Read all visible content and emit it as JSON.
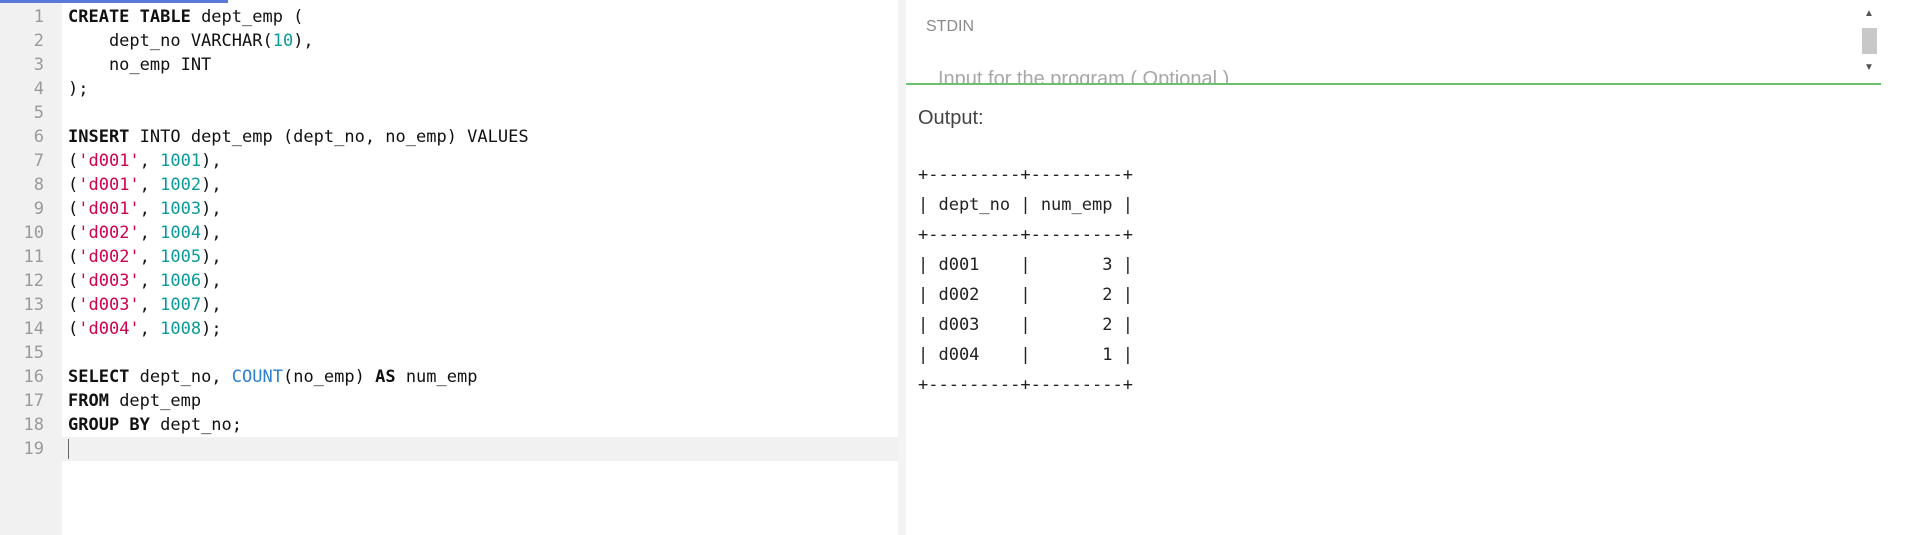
{
  "editor": {
    "lines": [
      {
        "n": "1",
        "tokens": [
          {
            "t": "CREATE TABLE",
            "c": "kw"
          },
          {
            "t": " dept_emp (",
            "c": ""
          }
        ]
      },
      {
        "n": "2",
        "tokens": [
          {
            "t": "    dept_no VARCHAR(",
            "c": ""
          },
          {
            "t": "10",
            "c": "num"
          },
          {
            "t": "),",
            "c": ""
          }
        ]
      },
      {
        "n": "3",
        "tokens": [
          {
            "t": "    no_emp INT",
            "c": ""
          }
        ]
      },
      {
        "n": "4",
        "tokens": [
          {
            "t": ");",
            "c": ""
          }
        ]
      },
      {
        "n": "5",
        "tokens": []
      },
      {
        "n": "6",
        "tokens": [
          {
            "t": "INSERT",
            "c": "kw"
          },
          {
            "t": " INTO dept_emp (dept_no, no_emp) VALUES",
            "c": ""
          }
        ]
      },
      {
        "n": "7",
        "tokens": [
          {
            "t": "(",
            "c": ""
          },
          {
            "t": "'d001'",
            "c": "str"
          },
          {
            "t": ", ",
            "c": ""
          },
          {
            "t": "1001",
            "c": "num"
          },
          {
            "t": "),",
            "c": ""
          }
        ]
      },
      {
        "n": "8",
        "tokens": [
          {
            "t": "(",
            "c": ""
          },
          {
            "t": "'d001'",
            "c": "str"
          },
          {
            "t": ", ",
            "c": ""
          },
          {
            "t": "1002",
            "c": "num"
          },
          {
            "t": "),",
            "c": ""
          }
        ]
      },
      {
        "n": "9",
        "tokens": [
          {
            "t": "(",
            "c": ""
          },
          {
            "t": "'d001'",
            "c": "str"
          },
          {
            "t": ", ",
            "c": ""
          },
          {
            "t": "1003",
            "c": "num"
          },
          {
            "t": "),",
            "c": ""
          }
        ]
      },
      {
        "n": "10",
        "tokens": [
          {
            "t": "(",
            "c": ""
          },
          {
            "t": "'d002'",
            "c": "str"
          },
          {
            "t": ", ",
            "c": ""
          },
          {
            "t": "1004",
            "c": "num"
          },
          {
            "t": "),",
            "c": ""
          }
        ]
      },
      {
        "n": "11",
        "tokens": [
          {
            "t": "(",
            "c": ""
          },
          {
            "t": "'d002'",
            "c": "str"
          },
          {
            "t": ", ",
            "c": ""
          },
          {
            "t": "1005",
            "c": "num"
          },
          {
            "t": "),",
            "c": ""
          }
        ]
      },
      {
        "n": "12",
        "tokens": [
          {
            "t": "(",
            "c": ""
          },
          {
            "t": "'d003'",
            "c": "str"
          },
          {
            "t": ", ",
            "c": ""
          },
          {
            "t": "1006",
            "c": "num"
          },
          {
            "t": "),",
            "c": ""
          }
        ]
      },
      {
        "n": "13",
        "tokens": [
          {
            "t": "(",
            "c": ""
          },
          {
            "t": "'d003'",
            "c": "str"
          },
          {
            "t": ", ",
            "c": ""
          },
          {
            "t": "1007",
            "c": "num"
          },
          {
            "t": "),",
            "c": ""
          }
        ]
      },
      {
        "n": "14",
        "tokens": [
          {
            "t": "(",
            "c": ""
          },
          {
            "t": "'d004'",
            "c": "str"
          },
          {
            "t": ", ",
            "c": ""
          },
          {
            "t": "1008",
            "c": "num"
          },
          {
            "t": ");",
            "c": ""
          }
        ]
      },
      {
        "n": "15",
        "tokens": []
      },
      {
        "n": "16",
        "tokens": [
          {
            "t": "SELECT",
            "c": "kw"
          },
          {
            "t": " dept_no, ",
            "c": ""
          },
          {
            "t": "COUNT",
            "c": "fn"
          },
          {
            "t": "(no_emp) ",
            "c": ""
          },
          {
            "t": "AS",
            "c": "kw"
          },
          {
            "t": " num_emp",
            "c": ""
          }
        ]
      },
      {
        "n": "17",
        "tokens": [
          {
            "t": "FROM",
            "c": "kw"
          },
          {
            "t": " dept_emp",
            "c": ""
          }
        ]
      },
      {
        "n": "18",
        "tokens": [
          {
            "t": "GROUP BY",
            "c": "kw"
          },
          {
            "t": " dept_no;",
            "c": ""
          }
        ]
      },
      {
        "n": "19",
        "tokens": [],
        "active": true
      }
    ]
  },
  "stdin": {
    "label": "STDIN",
    "placeholder": "Input for the program ( Optional )"
  },
  "output": {
    "label": "Output:",
    "text": "+---------+---------+\n| dept_no | num_emp |\n+---------+---------+\n| d001    |       3 |\n| d002    |       2 |\n| d003    |       2 |\n| d004    |       1 |\n+---------+---------+"
  },
  "colors": {
    "keyword": "#111111",
    "string": "#d1004e",
    "number": "#0a9a9a",
    "function": "#2b7fd1",
    "stdin_border": "#6cbf6c",
    "progress": "#5b79d9"
  },
  "icons": {
    "scroll_up": "triangle-up",
    "scroll_down": "triangle-down"
  }
}
